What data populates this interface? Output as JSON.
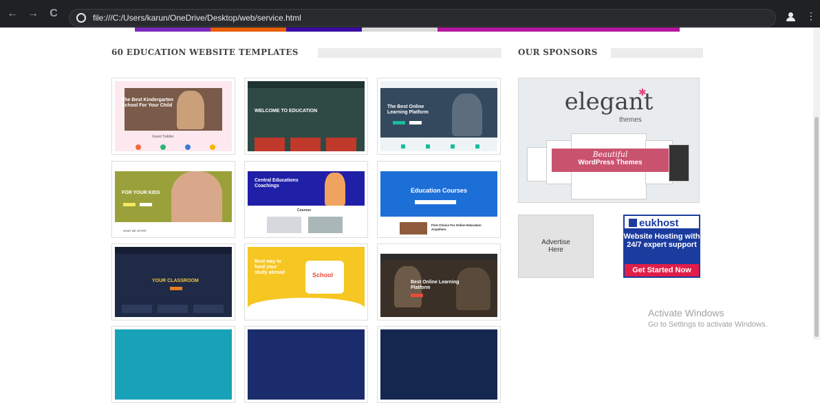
{
  "browser": {
    "url": "file:///C:/Users/karun/OneDrive/Desktop/web/service.html",
    "back_glyph": "←",
    "forward_glyph": "→",
    "reload_glyph": "C",
    "menu_glyph": "⋮"
  },
  "colors": {
    "chrome": "#202124",
    "strip": [
      "#7b2cbf",
      "#e85d04",
      "#3a0ca3",
      "#d9d9d9",
      "#b5179e"
    ],
    "eukhost_blue": "#1b3c9e",
    "eukhost_cta": "#e11d48",
    "ribbon": "#c9526e"
  },
  "templates_section": {
    "title": "60 EDUCATION WEBSITE TEMPLATES",
    "tiles": [
      {
        "name": "kindergarten",
        "headline": "The Best Kindergarten School For Your Child",
        "sub": "Grand Toddler"
      },
      {
        "name": "education-dark",
        "headline": "WELCOME TO EDUCATION",
        "sub": ""
      },
      {
        "name": "online-learning",
        "headline": "The Best Online Learning Platform",
        "sub": ""
      },
      {
        "name": "kids-green",
        "headline": "FOR YOUR KIDS",
        "sub": "WHAT WE OFFER"
      },
      {
        "name": "coaching",
        "headline": "Central Educations Coachings",
        "sub": "Courses"
      },
      {
        "name": "education-courses",
        "headline": "Education Courses",
        "sub": "First Choice For Online Education Anywhere"
      },
      {
        "name": "classroom",
        "headline": "YOUR CLASSROOM",
        "sub": ""
      },
      {
        "name": "school-yellow",
        "headline": "Best way to fund your study abroad",
        "sub": "School"
      },
      {
        "name": "learning-platform",
        "headline": "Best Online Learning Platform",
        "sub": ""
      },
      {
        "name": "partial-1",
        "headline": "",
        "sub": ""
      },
      {
        "name": "partial-2",
        "headline": "",
        "sub": ""
      },
      {
        "name": "partial-3",
        "headline": "",
        "sub": ""
      }
    ]
  },
  "sponsors_section": {
    "title": "OUR SPONSORS",
    "elegant": {
      "logo": "elegant",
      "logo_sub": "themes",
      "ribbon_line1": "Beautiful",
      "ribbon_line2": "WordPress Themes"
    },
    "advertise": {
      "line1": "Advertise",
      "line2": "Here"
    },
    "eukhost": {
      "brand": "eukhost",
      "message": "Website Hosting with 24/7 expert support",
      "cta": "Get Started Now"
    }
  },
  "watermark": {
    "line1": "Activate Windows",
    "line2": "Go to Settings to activate Windows."
  }
}
